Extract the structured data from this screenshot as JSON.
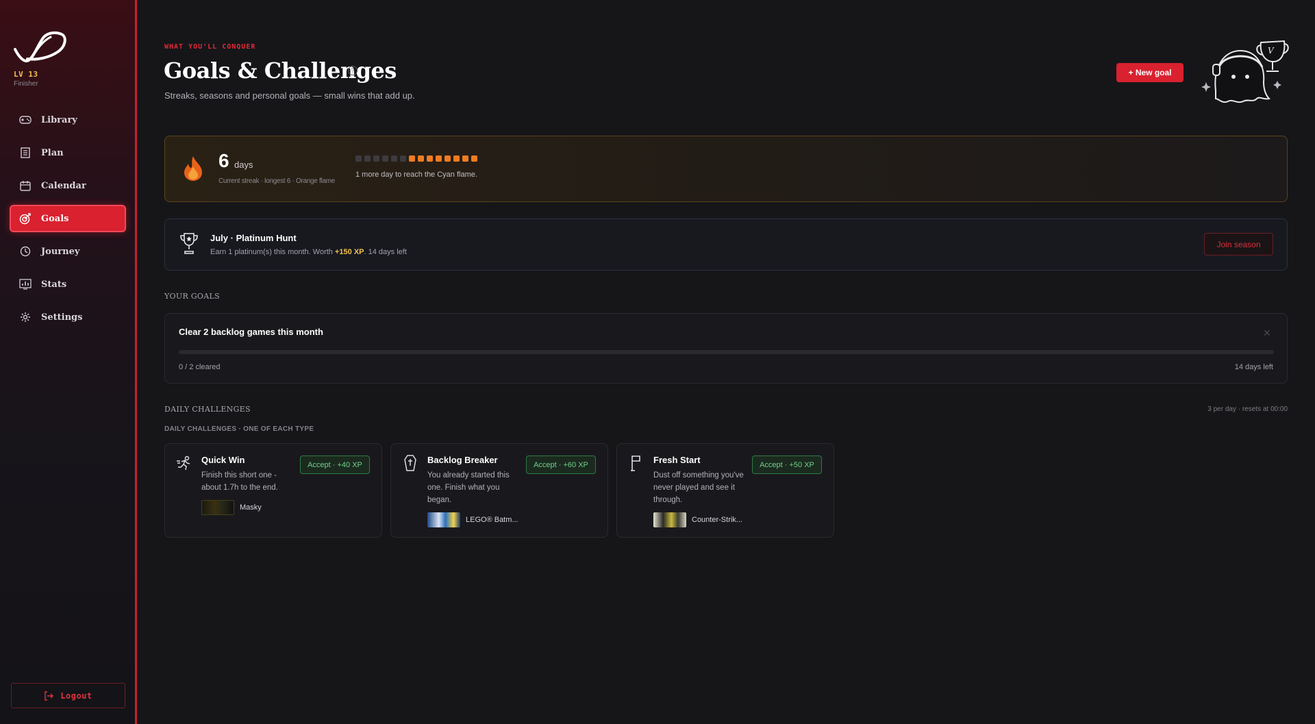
{
  "sidebar": {
    "level": "LV 13",
    "rank": "Finisher",
    "items": [
      {
        "label": "Library",
        "icon": "gamepad-icon"
      },
      {
        "label": "Plan",
        "icon": "checklist-icon"
      },
      {
        "label": "Calendar",
        "icon": "calendar-icon"
      },
      {
        "label": "Goals",
        "icon": "target-icon",
        "active": true
      },
      {
        "label": "Journey",
        "icon": "history-icon"
      },
      {
        "label": "Stats",
        "icon": "chart-icon"
      },
      {
        "label": "Settings",
        "icon": "gear-icon"
      }
    ],
    "logout_label": "Logout"
  },
  "header": {
    "eyebrow": "WHAT YOU'LL CONQUER",
    "title": "Goals & Challenges",
    "help": "?",
    "subtitle": "Streaks, seasons and personal goals — small wins that add up.",
    "new_goal_label": "+ New goal"
  },
  "streak": {
    "days": "6",
    "unit": "days",
    "sub": "Current streak · longest 6 · Orange flame",
    "total_dots": 14,
    "filled_dots": 8,
    "message": "1 more day to reach the Cyan flame.",
    "color_on": "#f07c22"
  },
  "season": {
    "title": "July · Platinum Hunt",
    "desc_prefix": "Earn 1 platinum(s) this month. Worth ",
    "xp": "+150 XP",
    "desc_suffix": ". 14 days left",
    "join_label": "Join season"
  },
  "goals_section": {
    "label": "YOUR GOALS",
    "goal": {
      "title": "Clear 2 backlog games this month",
      "close": "✕",
      "progress_fraction": 0,
      "count": "0 / 2 cleared",
      "days_left": "14 days left"
    }
  },
  "daily": {
    "label": "DAILY CHALLENGES",
    "meta": "3 per day · resets at 00:00",
    "sublabel": "DAILY CHALLENGES · ONE OF EACH TYPE",
    "challenges": [
      {
        "title": "Quick Win",
        "desc": "Finish this short one - about 1.7h to the end.",
        "accept": "Accept · +40 XP",
        "game": "Masky",
        "icon": "running-icon"
      },
      {
        "title": "Backlog Breaker",
        "desc": "You already started this one. Finish what you began.",
        "accept": "Accept · +60 XP",
        "game": "LEGO® Batm...",
        "icon": "coffin-icon"
      },
      {
        "title": "Fresh Start",
        "desc": "Dust off something you've never played and see it through.",
        "accept": "Accept · +50 XP",
        "game": "Counter-Strik...",
        "icon": "flag-icon"
      }
    ]
  },
  "colors": {
    "accent": "#d9212f",
    "xp_gold": "#f2c14e",
    "accept_green": "#6fd08a"
  }
}
